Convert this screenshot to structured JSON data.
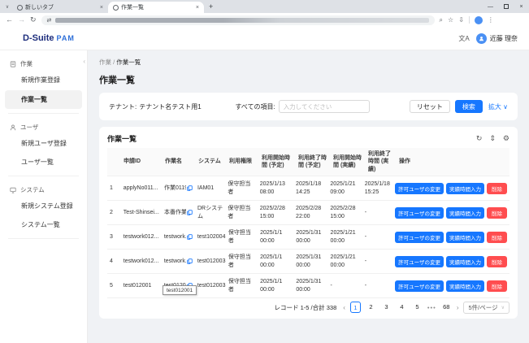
{
  "browser": {
    "tab_search_icon": "∨",
    "tabs": [
      {
        "title": "新しいタブ"
      },
      {
        "title": "作業一覧"
      }
    ],
    "close_glyph": "×",
    "new_tab_glyph": "+",
    "nav": {
      "back": "←",
      "forward": "→",
      "reload": "↻",
      "address_icon": "⇄"
    },
    "bar_icons": {
      "search": "⌕",
      "bookmark": "☆",
      "downloads": "⇩",
      "menu": "⋮"
    },
    "window": {
      "minimize": "—",
      "close": "×"
    }
  },
  "header": {
    "logo_primary": "D-Suite",
    "logo_secondary": "PAM",
    "translate_icon": "文A",
    "user_name": "近藤 理奈"
  },
  "sidebar": {
    "collapse_icon": "‹",
    "sections": [
      {
        "label": "作業",
        "items": [
          {
            "label": "新規作業登録"
          },
          {
            "label": "作業一覧"
          }
        ]
      },
      {
        "label": "ユーザ",
        "items": [
          {
            "label": "新規ユーザ登録"
          },
          {
            "label": "ユーザ一覧"
          }
        ]
      },
      {
        "label": "システム",
        "items": [
          {
            "label": "新規システム登録"
          },
          {
            "label": "システム一覧"
          }
        ]
      }
    ]
  },
  "breadcrumb": {
    "parent": "作業",
    "separator": "/",
    "current": "作業一覧"
  },
  "page": {
    "title": "作業一覧"
  },
  "filter": {
    "tenant_label": "テナント:",
    "tenant_value": "テナント名テスト用1",
    "field_label": "すべての項目:",
    "placeholder": "入力してください",
    "reset": "リセット",
    "search": "検索",
    "expand": "拡大",
    "expand_chevron": "∨"
  },
  "table": {
    "card_title": "作業一覧",
    "toolbar_icons": {
      "reload": "↻",
      "density": "⇕",
      "settings": "⚙"
    },
    "columns": {
      "apply_id": "申請ID",
      "work_name": "作業名",
      "system": "システム",
      "permission": "利用権限",
      "start_planned": "利用開始時間 (予定)",
      "end_planned": "利用終了時間 (予定)",
      "start_actual": "利用開始時間 (実績)",
      "end_actual": "利用終了時間 (実績)",
      "ops": "操作"
    },
    "action_labels": [
      "許可ユーザの変更",
      "実績時間入力",
      "削除"
    ],
    "rows": [
      {
        "num": "1",
        "apply_id": "applyNo011...",
        "work_name": "作業0119...",
        "system": "IAM01",
        "permission": "保守担当者",
        "start_planned": "2025/1/13 08:00",
        "end_planned": "2025/1/18 14:25",
        "start_actual": "2025/1/21 09:00",
        "end_actual": "2025/1/18 15:25"
      },
      {
        "num": "2",
        "apply_id": "Test-Shinsei...",
        "work_name": "本番作業...",
        "system": "DRシステム",
        "permission": "保守担当者",
        "start_planned": "2025/2/28 15:00",
        "end_planned": "2025/2/28 22:00",
        "start_actual": "2025/2/28 15:00",
        "end_actual": "-"
      },
      {
        "num": "3",
        "apply_id": "testwork012...",
        "work_name": "testwork...",
        "system": "test102004",
        "permission": "保守担当者",
        "start_planned": "2025/1/1 00:00",
        "end_planned": "2025/1/31 00:00",
        "start_actual": "2025/1/21 00:00",
        "end_actual": "-"
      },
      {
        "num": "4",
        "apply_id": "testwork012...",
        "work_name": "testwork...",
        "system": "test012003",
        "permission": "保守担当者",
        "start_planned": "2025/1/1 00:00",
        "end_planned": "2025/1/31 00:00",
        "start_actual": "2025/1/21 00:00",
        "end_actual": "-"
      },
      {
        "num": "5",
        "apply_id": "test012001",
        "work_name": "test0120...",
        "system": "test012003",
        "permission": "保守担当者",
        "start_planned": "2025/1/1 00:00",
        "end_planned": "2025/1/31 00:00",
        "start_actual": "-",
        "end_actual": "-"
      }
    ]
  },
  "pagination": {
    "summary": "レコード 1-5 /合計 338",
    "prev": "‹",
    "next": "›",
    "pages": [
      "1",
      "2",
      "3",
      "4",
      "5"
    ],
    "current": "1",
    "ellipsis": "•••",
    "last_page": "68",
    "page_size": "5件/ページ",
    "chevron": "∨"
  },
  "tooltip": {
    "text": "test012001"
  }
}
